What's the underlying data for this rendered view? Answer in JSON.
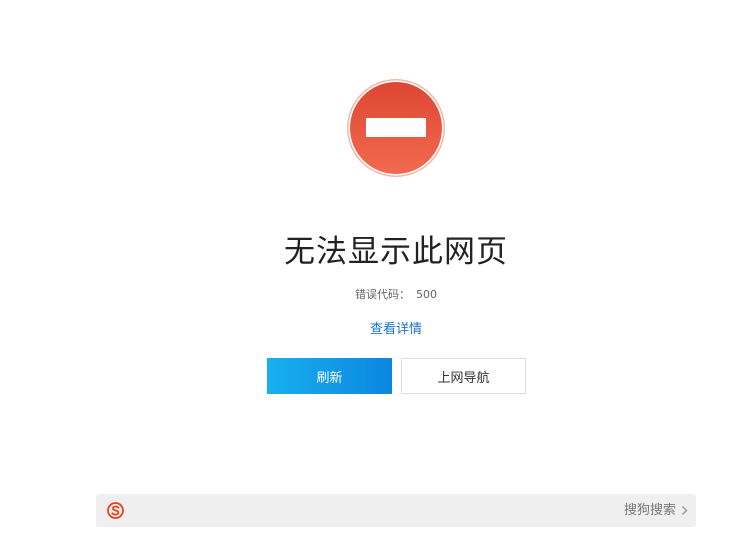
{
  "error": {
    "title": "无法显示此网页",
    "code_label": "错误代码：",
    "code_value": "500",
    "details_link": "查看详情"
  },
  "buttons": {
    "refresh_label": "刷新",
    "nav_label": "上网导航"
  },
  "bottom_bar": {
    "search_label": "搜狗搜索"
  },
  "icons": {
    "error": "no-entry-icon",
    "logo": "sogou-logo-icon",
    "chevron": "chevron-right-icon"
  },
  "colors": {
    "error_icon": "#e8503a",
    "refresh_button": "#0a86e0",
    "link": "#1a73c8",
    "logo": "#e8421e"
  }
}
